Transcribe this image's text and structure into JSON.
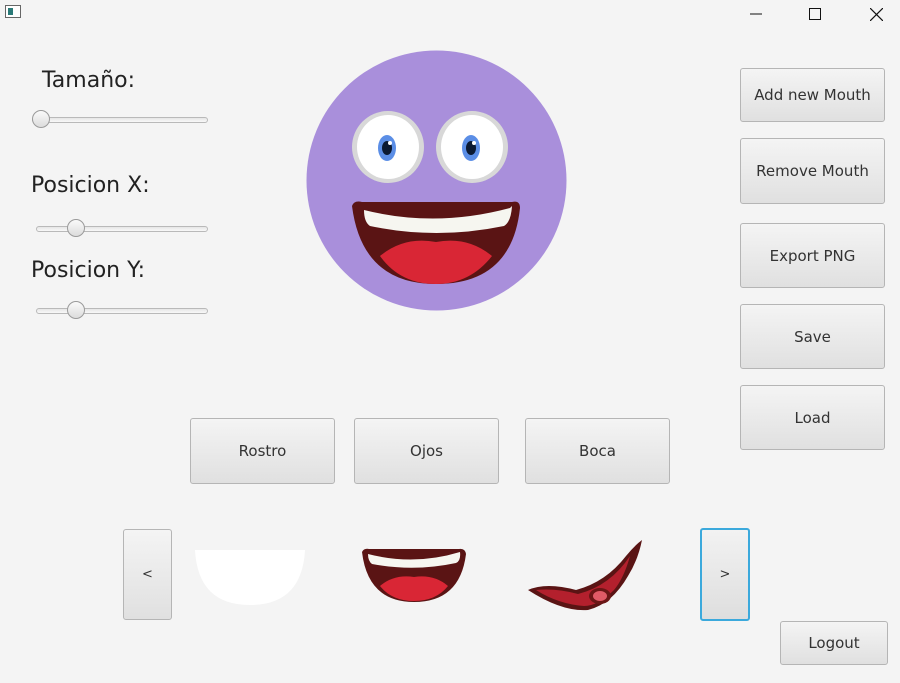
{
  "window": {
    "icon": "app-window-icon",
    "controls": [
      "minimize-icon",
      "maximize-icon",
      "close-icon"
    ]
  },
  "sliders": [
    {
      "label": "Tamaño:",
      "value": 0.0
    },
    {
      "label": "Posicion X:",
      "value": 0.2
    },
    {
      "label": "Posicion Y:",
      "value": 0.2
    }
  ],
  "side_buttons": {
    "add_mouth": "Add new Mouth",
    "remove_mouth": "Remove Mouth",
    "export_png": "Export PNG",
    "save": "Save",
    "load": "Load"
  },
  "category_tabs": {
    "rostro": "Rostro",
    "ojos": "Ojos",
    "boca": "Boca"
  },
  "carousel": {
    "prev": "<",
    "next": ">",
    "options": [
      "white-half-mouth",
      "laughing-mouth",
      "dark-red-grin-mouth"
    ]
  },
  "logout": "Logout",
  "colors": {
    "face": "#a98fdb",
    "iris": "#5b8ee6",
    "mouth_dark": "#5a1414",
    "tongue": "#d92635",
    "focus": "#3ba9dc"
  }
}
